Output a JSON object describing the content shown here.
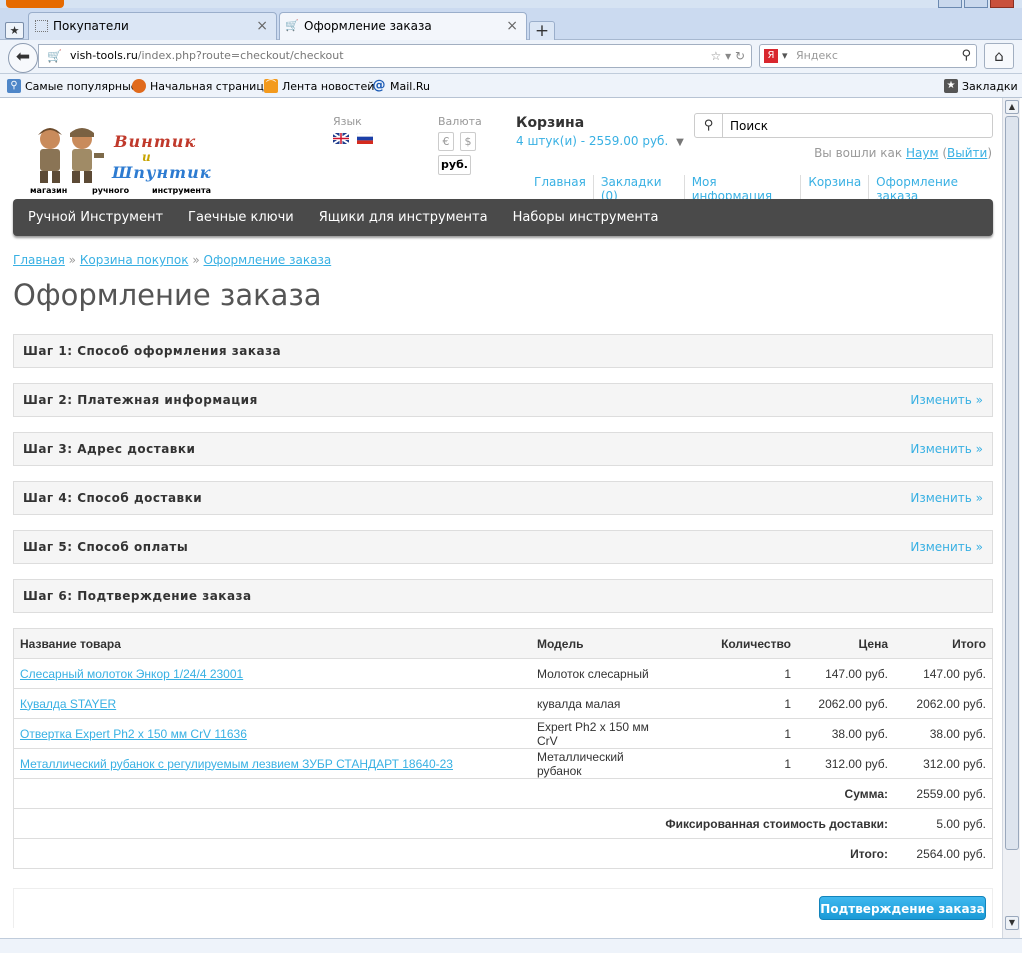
{
  "browser": {
    "tabs": [
      {
        "label": "Покупатели",
        "active": false
      },
      {
        "label": "Оформление заказа",
        "active": true
      }
    ],
    "url_host": "vish-tools.ru",
    "url_path": "/index.php?route=checkout/checkout",
    "search_placeholder": "Яндекс",
    "bookmarks": [
      "Самые популярные",
      "Начальная страница",
      "Лента новостей",
      "Mail.Ru"
    ],
    "bookmarks_menu": "Закладки"
  },
  "header": {
    "logo_word1": "Винтик",
    "logo_word2": "и",
    "logo_word3": "Шпунтик",
    "logo_caption": [
      "магазин",
      "ручного",
      "инструмента"
    ],
    "lang_label": "Язык",
    "currency_label": "Валюта",
    "currency_euro": "€",
    "currency_usd": "$",
    "currency_rub": "руб.",
    "cart_title": "Корзина",
    "cart_summary": "4 штук(и) - 2559.00 руб.",
    "search_placeholder": "Поиск",
    "welcome_prefix": "Вы вошли как",
    "welcome_user": "Наум",
    "welcome_open": "(",
    "welcome_logout": "Выйти",
    "welcome_close": ")",
    "links": [
      "Главная",
      "Закладки (0)",
      "Моя информация",
      "Корзина",
      "Оформление заказа"
    ]
  },
  "menu": [
    "Ручной Инструмент",
    "Гаечные ключи",
    "Ящики для инструмента",
    "Наборы инструмента"
  ],
  "breadcrumb": [
    "Главная",
    "Корзина покупок",
    "Оформление заказа"
  ],
  "breadcrumb_sep": "»",
  "title": "Оформление заказа",
  "steps": [
    {
      "title": "Шаг 1: Способ оформления заказа",
      "edit": ""
    },
    {
      "title": "Шаг 2: Платежная информация",
      "edit": "Изменить »"
    },
    {
      "title": "Шаг 3: Адрес доставки",
      "edit": "Изменить »"
    },
    {
      "title": "Шаг 4: Способ доставки",
      "edit": "Изменить »"
    },
    {
      "title": "Шаг 5: Способ оплаты",
      "edit": "Изменить »"
    },
    {
      "title": "Шаг 6: Подтверждение заказа",
      "edit": ""
    }
  ],
  "table": {
    "headers": [
      "Название товара",
      "Модель",
      "Количество",
      "Цена",
      "Итого"
    ],
    "rows": [
      {
        "name": "Слесарный молоток Энкор 1/24/4 23001",
        "model": "Молоток слесарный",
        "qty": "1",
        "price": "147.00 руб.",
        "total": "147.00 руб."
      },
      {
        "name": "Кувалда STAYER",
        "model": "кувалда малая",
        "qty": "1",
        "price": "2062.00 руб.",
        "total": "2062.00 руб."
      },
      {
        "name": "Отвертка Expert Ph2 x 150 мм CrV 11636",
        "model": "Expert Ph2 x 150 мм CrV",
        "qty": "1",
        "price": "38.00 руб.",
        "total": "38.00 руб."
      },
      {
        "name": "Металлический рубанок с регулируемым лезвием ЗУБР СТАНДАРТ 18640-23",
        "model": "Металлический рубанок",
        "qty": "1",
        "price": "312.00 руб.",
        "total": "312.00 руб."
      }
    ],
    "totals": [
      {
        "label": "Сумма:",
        "value": "2559.00 руб."
      },
      {
        "label": "Фиксированная стоимость доставки:",
        "value": "5.00 руб."
      },
      {
        "label": "Итого:",
        "value": "2564.00 руб."
      }
    ]
  },
  "confirm_label": "Подтверждение заказа",
  "colors": {
    "accent": "#38b0e3",
    "menu_bg": "#4a4a4a",
    "button": "#1a9ad6"
  }
}
